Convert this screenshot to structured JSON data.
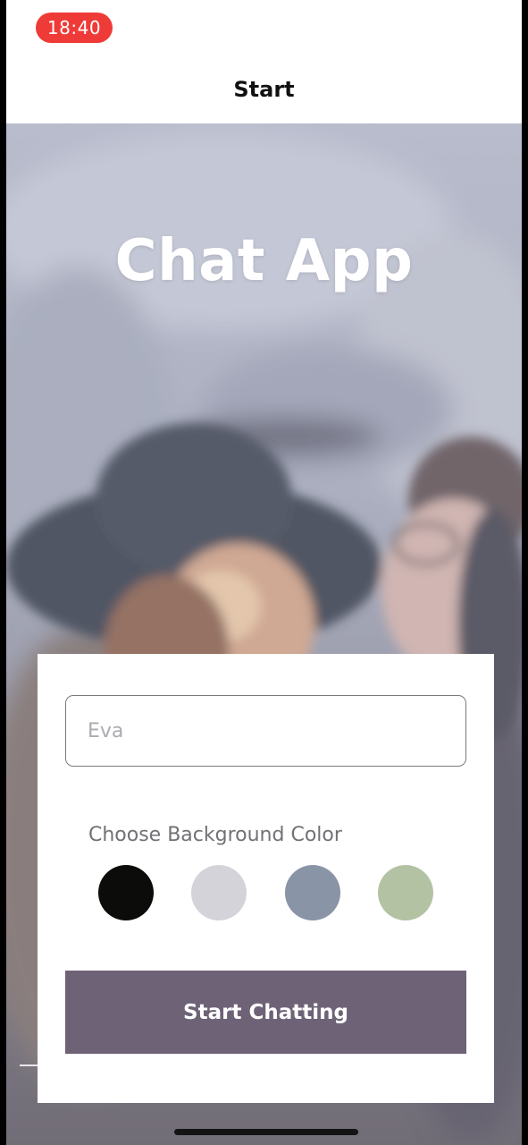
{
  "status_bar": {
    "time": "18:40"
  },
  "nav": {
    "title": "Start"
  },
  "hero": {
    "app_title": "Chat App"
  },
  "form": {
    "name_input": {
      "value": "",
      "placeholder": "Eva"
    },
    "color_label": "Choose Background Color",
    "colors": [
      "#0c0c0a",
      "#d5d3da",
      "#8a94a7",
      "#b4c2a4"
    ],
    "start_button_label": "Start Chatting",
    "button_color": "#6e6277"
  },
  "icons": {
    "background_image": "photo-two-women-laughing"
  }
}
